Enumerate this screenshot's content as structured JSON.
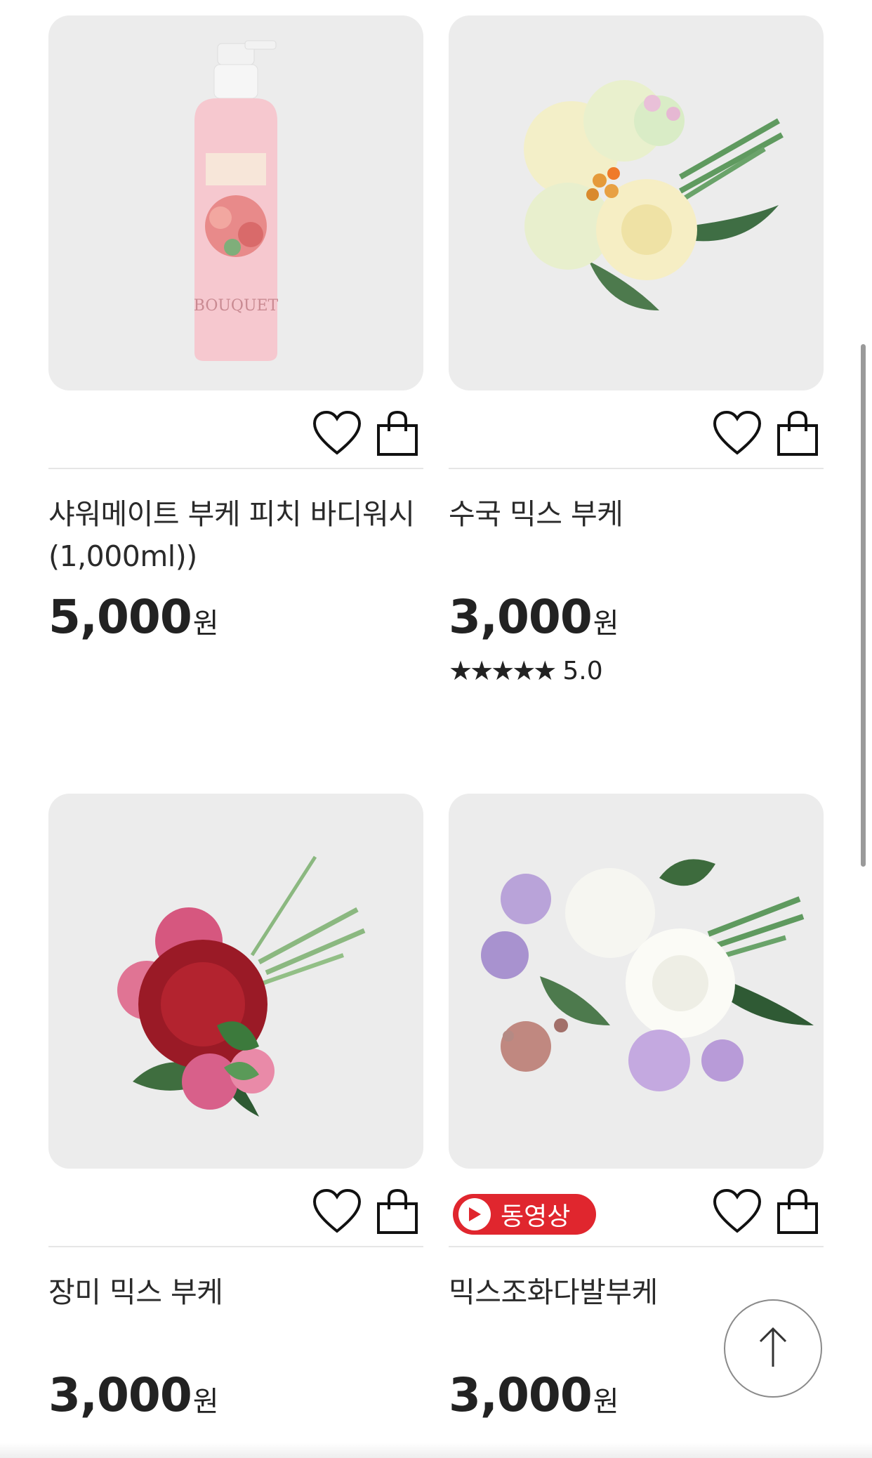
{
  "products": [
    {
      "title": "샤워메이트 부케 피치 바디워시(1,000ml))",
      "price": "5,000",
      "currency": "원",
      "has_video": false,
      "rating_stars": "",
      "rating_value": "",
      "image": "pink-bodywash-bottle"
    },
    {
      "title": "수국 믹스 부케",
      "price": "3,000",
      "currency": "원",
      "has_video": false,
      "rating_stars": "★★★★★",
      "rating_value": "5.0",
      "image": "cream-hydrangea-bouquet"
    },
    {
      "title": "장미 믹스 부케",
      "price": "3,000",
      "currency": "원",
      "has_video": false,
      "rating_stars": "",
      "rating_value": "",
      "image": "red-chrysanthemum-bouquet"
    },
    {
      "title": "믹스조화다발부케",
      "price": "3,000",
      "currency": "원",
      "has_video": true,
      "rating_stars": "",
      "rating_value": "",
      "image": "white-rose-lavender-bouquet"
    }
  ],
  "video_badge_label": "동영상",
  "icons": {
    "wishlist": "heart-icon",
    "cart": "shopping-bag-icon",
    "scroll_top": "arrow-up-icon",
    "video": "play-icon"
  },
  "colors": {
    "video_badge": "#e0262e",
    "thumb_bg": "#ececec"
  }
}
